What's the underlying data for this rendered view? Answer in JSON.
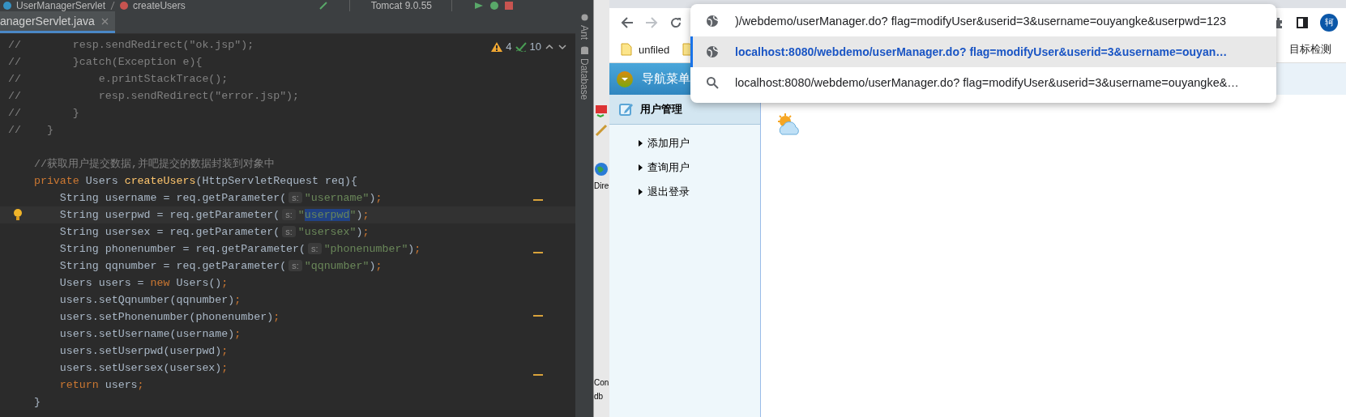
{
  "ide": {
    "breadcrumb": [
      "UserManagerServlet",
      "createUsers"
    ],
    "run_config": "Tomcat 9.0.55",
    "tab": {
      "label": "anagerServlet.java"
    },
    "inspections": {
      "warnings": "4",
      "ok": "10"
    },
    "code_lines": [
      {
        "current": false,
        "tokens": [
          {
            "kind": "comment",
            "text": "//        resp.sendRedirect(\"ok.jsp\");"
          }
        ]
      },
      {
        "current": false,
        "tokens": [
          {
            "kind": "comment",
            "text": "//        }catch(Exception e){"
          }
        ]
      },
      {
        "current": false,
        "tokens": [
          {
            "kind": "comment",
            "text": "//            e.printStackTrace();"
          }
        ]
      },
      {
        "current": false,
        "tokens": [
          {
            "kind": "comment",
            "text": "//            resp.sendRedirect(\"error.jsp\");"
          }
        ]
      },
      {
        "current": false,
        "tokens": [
          {
            "kind": "comment",
            "text": "//        }"
          }
        ]
      },
      {
        "current": false,
        "tokens": [
          {
            "kind": "comment",
            "text": "//    }"
          }
        ]
      },
      {
        "current": false
      },
      {
        "current": false,
        "tokens": [
          {
            "kind": "comment",
            "text": "    //获取用户提交数据,并吧提交的数据封装到对象中"
          }
        ]
      },
      {
        "current": false,
        "tokens": [
          {
            "kind": "keyword",
            "text": "    private "
          },
          {
            "kind": "plain",
            "text": "Users "
          },
          {
            "kind": "method",
            "text": "createUsers"
          },
          {
            "kind": "plain",
            "text": "(HttpServletRequest req){"
          }
        ]
      },
      {
        "current": false,
        "tokens": [
          {
            "kind": "plain",
            "text": "        String username = req.getParameter("
          },
          {
            "kind": "hint",
            "text": "s:"
          },
          {
            "kind": "string",
            "text": "\"username\""
          },
          {
            "kind": "plain",
            "text": ")"
          },
          {
            "kind": "punct",
            "text": ";"
          }
        ]
      },
      {
        "current": true,
        "tokens": [
          {
            "kind": "plain",
            "text": "        String userpwd = req.getParameter("
          },
          {
            "kind": "hint",
            "text": "s:"
          },
          {
            "kind": "string",
            "text": "\""
          },
          {
            "kind": "selection",
            "text": "userpwd"
          },
          {
            "kind": "string",
            "text": "\""
          },
          {
            "kind": "plain",
            "text": ")"
          },
          {
            "kind": "punct",
            "text": ";"
          }
        ]
      },
      {
        "current": false,
        "tokens": [
          {
            "kind": "plain",
            "text": "        String usersex = req.getParameter("
          },
          {
            "kind": "hint",
            "text": "s:"
          },
          {
            "kind": "string",
            "text": "\"usersex\""
          },
          {
            "kind": "plain",
            "text": ")"
          },
          {
            "kind": "punct",
            "text": ";"
          }
        ]
      },
      {
        "current": false,
        "tokens": [
          {
            "kind": "plain",
            "text": "        String phonenumber = req.getParameter("
          },
          {
            "kind": "hint",
            "text": "s:"
          },
          {
            "kind": "string",
            "text": "\"phonenumber\""
          },
          {
            "kind": "plain",
            "text": ")"
          },
          {
            "kind": "punct",
            "text": ";"
          }
        ]
      },
      {
        "current": false,
        "tokens": [
          {
            "kind": "plain",
            "text": "        String qqnumber = req.getParameter("
          },
          {
            "kind": "hint",
            "text": "s:"
          },
          {
            "kind": "string",
            "text": "\"qqnumber\""
          },
          {
            "kind": "plain",
            "text": ")"
          },
          {
            "kind": "punct",
            "text": ";"
          }
        ]
      },
      {
        "current": false,
        "tokens": [
          {
            "kind": "plain",
            "text": "        Users users = "
          },
          {
            "kind": "keyword",
            "text": "new"
          },
          {
            "kind": "plain",
            "text": " Users()"
          },
          {
            "kind": "punct",
            "text": ";"
          }
        ]
      },
      {
        "current": false,
        "tokens": [
          {
            "kind": "plain",
            "text": "        users.setQqnumber(qqnumber)"
          },
          {
            "kind": "punct",
            "text": ";"
          }
        ]
      },
      {
        "current": false,
        "tokens": [
          {
            "kind": "plain",
            "text": "        users.setPhonenumber(phonenumber)"
          },
          {
            "kind": "punct",
            "text": ";"
          }
        ]
      },
      {
        "current": false,
        "tokens": [
          {
            "kind": "plain",
            "text": "        users.setUsername(username)"
          },
          {
            "kind": "punct",
            "text": ";"
          }
        ]
      },
      {
        "current": false,
        "tokens": [
          {
            "kind": "plain",
            "text": "        users.setUserpwd(userpwd)"
          },
          {
            "kind": "punct",
            "text": ";"
          }
        ]
      },
      {
        "current": false,
        "tokens": [
          {
            "kind": "plain",
            "text": "        users.setUsersex(usersex)"
          },
          {
            "kind": "punct",
            "text": ";"
          }
        ]
      },
      {
        "current": false,
        "tokens": [
          {
            "kind": "keyword",
            "text": "        return"
          },
          {
            "kind": "plain",
            "text": " users"
          },
          {
            "kind": "punct",
            "text": ";"
          }
        ]
      },
      {
        "current": false,
        "tokens": [
          {
            "kind": "plain",
            "text": "    }"
          }
        ]
      }
    ],
    "tool_windows": [
      "Ant",
      "Database"
    ]
  },
  "background_window": {
    "texts": [
      "Dire",
      "Con",
      "db"
    ]
  },
  "browser": {
    "avatar": "轲",
    "bookmarks": [
      {
        "kind": "folder",
        "label": "unfiled"
      },
      {
        "kind": "folder"
      }
    ],
    "other_bookmark": "目标检测",
    "suggestions": [
      {
        "kind": "url",
        "selected": false,
        "text": ")/webdemo/userManager.do?  flag=modifyUser&userid=3&username=ouyangke&userpwd=123"
      },
      {
        "kind": "url",
        "selected": true,
        "text": "localhost:8080/webdemo/userManager.do?  flag=modifyUser&userid=3&username=ouyan…"
      },
      {
        "kind": "search",
        "selected": false,
        "text": "localhost:8080/webdemo/userManager.do?  flag=modifyUser&userid=3&username=ouyangke&…"
      }
    ],
    "page": {
      "nav_title": "导航菜单",
      "section": "用户管理",
      "menu_items": [
        "添加用户",
        "查询用户",
        "退出登录"
      ]
    }
  }
}
